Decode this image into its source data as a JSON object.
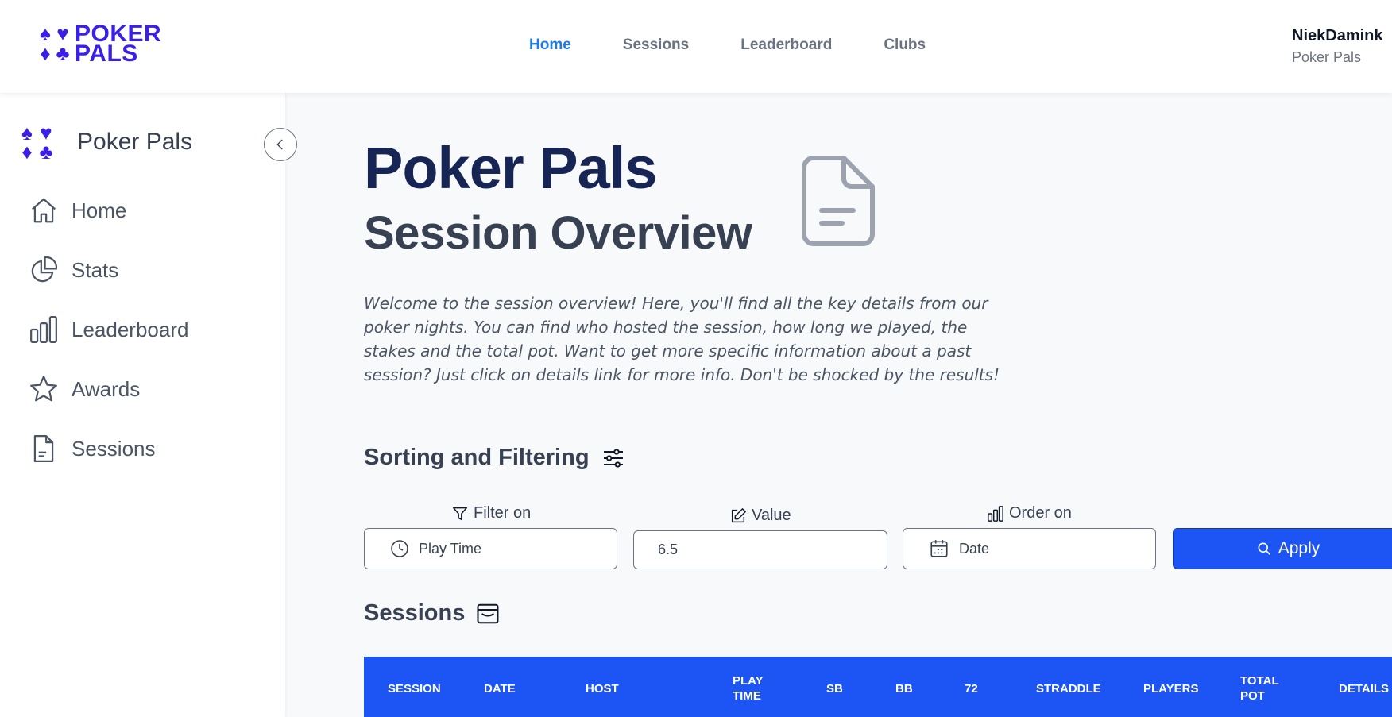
{
  "topbar": {
    "logo_line1": "POKER",
    "logo_line2": "PALS",
    "nav": [
      {
        "label": "Home",
        "active": true
      },
      {
        "label": "Sessions"
      },
      {
        "label": "Leaderboard"
      },
      {
        "label": "Clubs"
      }
    ],
    "user_name": "NiekDamink",
    "user_club": "Poker Pals"
  },
  "sidebar": {
    "brand": "Poker Pals",
    "items": [
      {
        "label": "Home",
        "icon": "home-icon"
      },
      {
        "label": "Stats",
        "icon": "pie-chart-icon"
      },
      {
        "label": "Leaderboard",
        "icon": "bar-chart-icon"
      },
      {
        "label": "Awards",
        "icon": "star-icon"
      },
      {
        "label": "Sessions",
        "icon": "document-icon"
      }
    ]
  },
  "main": {
    "title": "Poker Pals",
    "subtitle": "Session Overview",
    "intro": "Welcome to the session overview! Here, you'll find all the key details from our poker nights. You can find who hosted the session, how long we played, the stakes and the total pot. Want to get more specific information about a past session? Just click on details link for more info. Don't be shocked by the results!",
    "sorting_title": "Sorting and Filtering",
    "filter_label": "Filter on",
    "filter_value": "Play Time",
    "value_label": "Value",
    "value_input": "6.5",
    "order_label": "Order on",
    "order_value": "Date",
    "apply_label": "Apply",
    "sessions_title": "Sessions",
    "columns": [
      "SESSION",
      "DATE",
      "HOST",
      "PLAY TIME",
      "SB",
      "BB",
      "72",
      "STRADDLE",
      "PLAYERS",
      "TOTAL POT",
      "DETAILS"
    ]
  },
  "colors": {
    "brand": "#3a20e6",
    "accent": "#1c55f4",
    "nav_active": "#1d7be5",
    "title": "#172554"
  }
}
